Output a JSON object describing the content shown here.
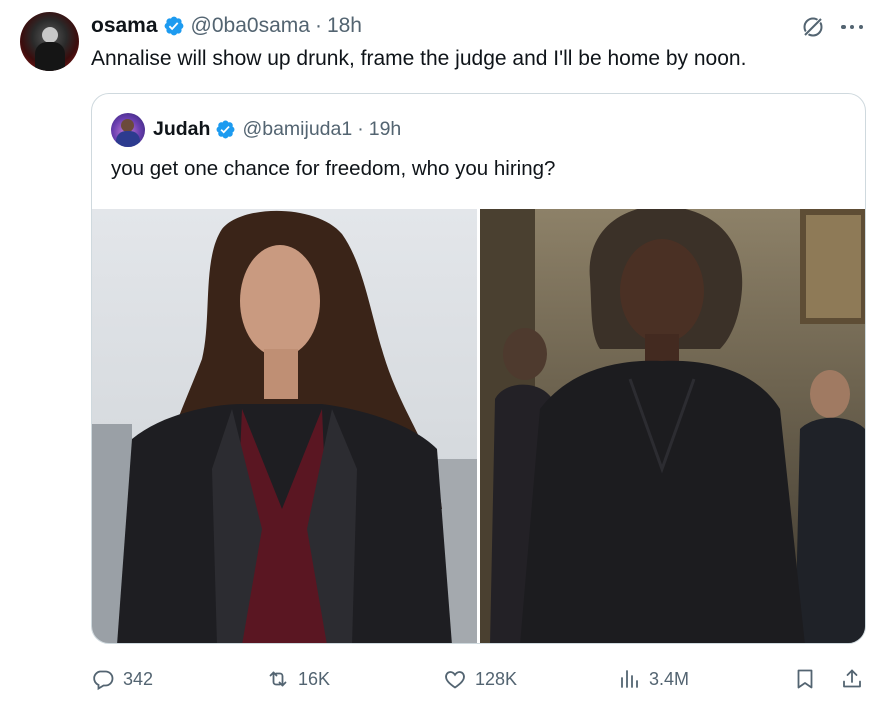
{
  "tweet": {
    "author_name": "osama",
    "author_handle": "@0ba0sama",
    "time": "18h",
    "separator": "·",
    "text": "Annalise will show up drunk, frame the judge and I'll be home by noon."
  },
  "quoted_tweet": {
    "author_name": "Judah",
    "author_handle": "@bamijuda1",
    "time": "19h",
    "separator": "·",
    "text": "you get one chance for freedom, who you hiring?",
    "media": [
      {
        "icon": "photo-woman-long-hair-burgundy-blouse"
      },
      {
        "icon": "photo-woman-black-dress-courtroom"
      }
    ]
  },
  "actions": {
    "replies": "342",
    "reposts": "16K",
    "likes": "128K",
    "views": "3.4M"
  },
  "colors": {
    "verified": "#1d9bf0",
    "secondary_text": "#536471",
    "border": "#cfd9de",
    "primary_text": "#0f1419"
  }
}
